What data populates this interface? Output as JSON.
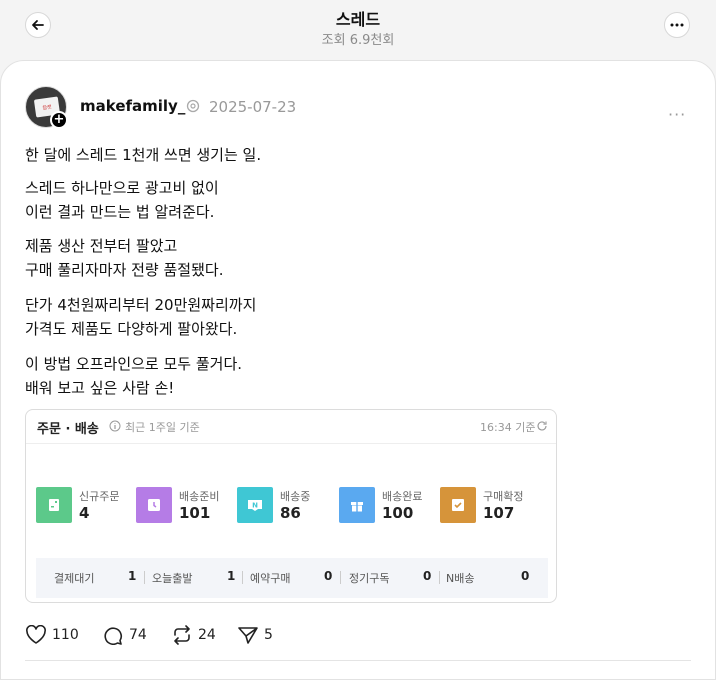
{
  "header": {
    "title": "스레드",
    "views": "조회 6.9천회"
  },
  "post": {
    "username": "makefamily_",
    "date": "2025-07-23",
    "avatar_text": "참캣",
    "paragraphs": [
      [
        "한 달에 스레드 1천개 쓰면 생기는 일."
      ],
      [
        "스레드 하나만으로 광고비 없이",
        "이런 결과 만드는 법 알려준다."
      ],
      [
        "제품 생산 전부터 팔았고",
        "구매 풀리자마자 전량 품절됐다."
      ],
      [
        "단가 4천원짜리부터 20만원짜리까지",
        "가격도 제품도 다양하게 팔아왔다."
      ],
      [
        "이 방법 오프라인으로 모두 풀거다.",
        "배워 보고 싶은 사람 손!"
      ]
    ]
  },
  "panel": {
    "title": "주문 · 배송",
    "subtitle": "최근 1주일 기준",
    "time": "16:34 기준",
    "stats": [
      {
        "label": "신규주문",
        "value": "4",
        "color": "#5cc98a",
        "icon": "new-order-icon"
      },
      {
        "label": "배송준비",
        "value": "101",
        "color": "#b57ce6",
        "icon": "clock-icon"
      },
      {
        "label": "배송중",
        "value": "86",
        "color": "#3fc7d4",
        "icon": "delivery-icon"
      },
      {
        "label": "배송완료",
        "value": "100",
        "color": "#5aa9f0",
        "icon": "gift-icon"
      },
      {
        "label": "구매확정",
        "value": "107",
        "color": "#d6943a",
        "icon": "check-icon"
      }
    ],
    "bottom": [
      {
        "label": "결제대기",
        "value": "1"
      },
      {
        "label": "오늘출발",
        "value": "1"
      },
      {
        "label": "예약구매",
        "value": "0"
      },
      {
        "label": "정기구독",
        "value": "0"
      },
      {
        "label": "N배송",
        "value": "0"
      }
    ]
  },
  "actions": {
    "likes": "110",
    "comments": "74",
    "reposts": "24",
    "shares": "5"
  }
}
